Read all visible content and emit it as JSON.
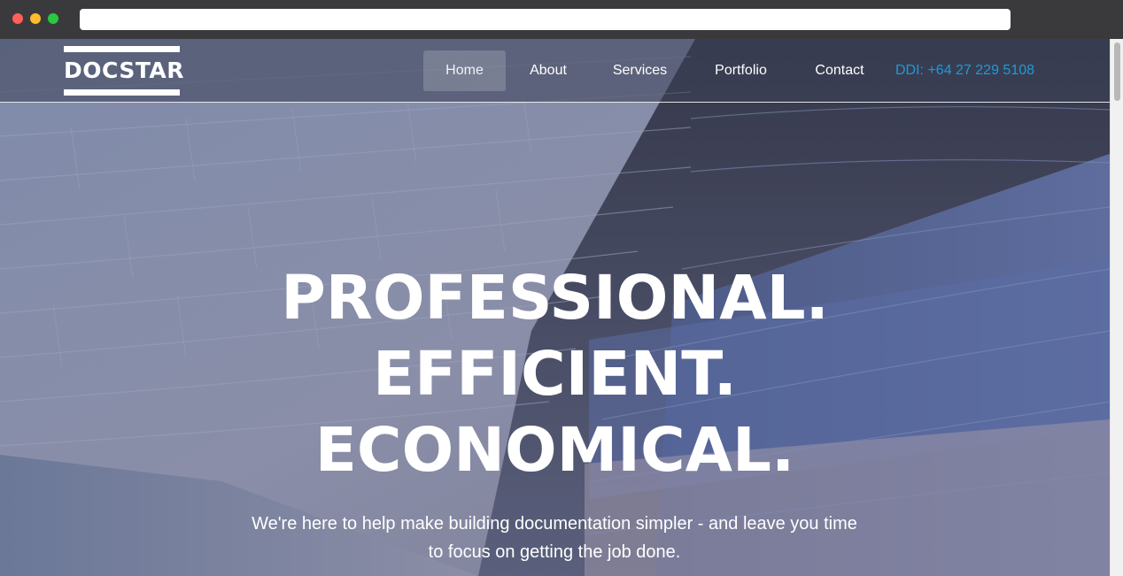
{
  "site": {
    "logo_text": "DOCSTAR"
  },
  "nav": {
    "items": [
      {
        "label": "Home",
        "active": true
      },
      {
        "label": "About"
      },
      {
        "label": "Services"
      },
      {
        "label": "Portfolio"
      },
      {
        "label": "Contact"
      }
    ],
    "phone": "DDI: +64 27 229 5108"
  },
  "hero": {
    "headline_lines": [
      "PROFESSIONAL.",
      "EFFICIENT.",
      "ECONOMICAL."
    ],
    "tagline": "We're here to help make building documentation simpler - and leave you time to focus on getting the job done."
  },
  "colors": {
    "accent_phone": "#1d9bd8",
    "text": "#ffffff"
  }
}
